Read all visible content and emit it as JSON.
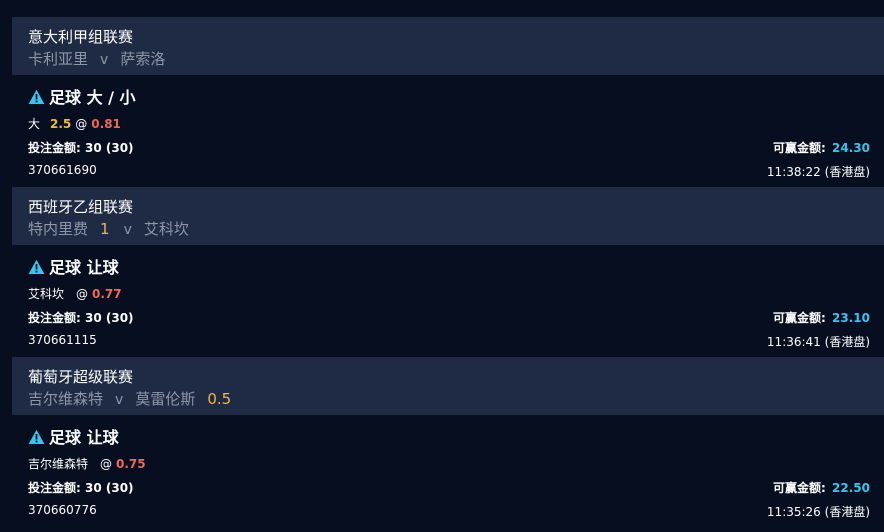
{
  "colors": {
    "background": "#060e1f",
    "header_bar": "#1f2a44",
    "team_text": "#8e97a8",
    "handicap": "#f4b63e",
    "odds": "#f0675a",
    "win_amount": "#35c5ef",
    "warning_icon": "#35c5ef"
  },
  "labels": {
    "stake_label": "投注金额:",
    "win_label": "可赢金额:",
    "vs": "v",
    "at": "@"
  },
  "bets": [
    {
      "league": "意大利甲组联赛",
      "home_team": "卡利亚里",
      "away_team": "萨索洛",
      "handicap_home": "",
      "handicap_away": "",
      "warning_icon": "warning-triangle-icon",
      "market": "足球 大 / 小",
      "selection": "大",
      "line": "2.5",
      "odds": "0.81",
      "stake": "30 (30)",
      "win_amount": "24.30",
      "ref_id": "370661690",
      "time": "11:38:22 (香港盘)"
    },
    {
      "league": "西班牙乙组联赛",
      "home_team": "特内里费",
      "away_team": "艾科坎",
      "handicap_home": "1",
      "handicap_away": "",
      "warning_icon": "warning-triangle-icon",
      "market": "足球 让球",
      "selection": "艾科坎",
      "line": "",
      "odds": "0.77",
      "stake": "30 (30)",
      "win_amount": "23.10",
      "ref_id": "370661115",
      "time": "11:36:41 (香港盘)"
    },
    {
      "league": "葡萄牙超级联赛",
      "home_team": "吉尔维森特",
      "away_team": "莫雷伦斯",
      "handicap_home": "",
      "handicap_away": "0.5",
      "warning_icon": "warning-triangle-icon",
      "market": "足球 让球",
      "selection": "吉尔维森特",
      "line": "",
      "odds": "0.75",
      "stake": "30 (30)",
      "win_amount": "22.50",
      "ref_id": "370660776",
      "time": "11:35:26 (香港盘)"
    }
  ]
}
